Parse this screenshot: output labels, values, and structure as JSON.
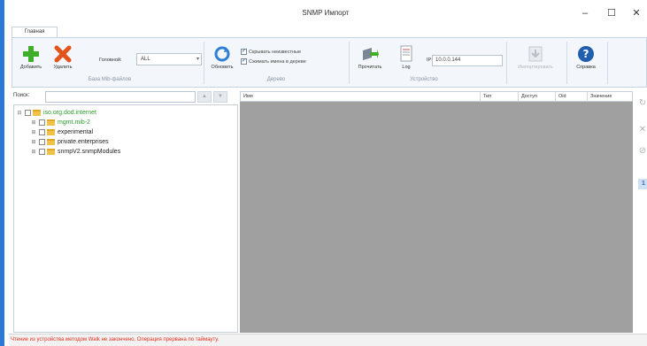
{
  "window": {
    "title": "SNMP Импорт",
    "minimize": "–",
    "maximize": "☐",
    "close": "✕"
  },
  "ribbon": {
    "tab": "Главная",
    "mib_group": {
      "add_label": "Добавить",
      "delete_label": "Удалить",
      "head_label": "Головной:",
      "head_value": "ALL",
      "group_label": "База Mib-файлов"
    },
    "tree_group": {
      "refresh_label": "Обновить",
      "hide_unknown_label": "Скрывать неизвестные",
      "compress_names_label": "Сжимать имена в дереве",
      "group_label": "Дерево"
    },
    "device_group": {
      "read_label": "Прочитать",
      "log_label": "Log",
      "ip_label": "IP:",
      "ip_value": "10.0.0.144",
      "group_label": "Устройство"
    },
    "import_label": "Импортировать",
    "help_label": "Справка"
  },
  "search": {
    "label": "Поиск:",
    "value": ""
  },
  "tree": {
    "root": "iso.org.dod.internet",
    "children": [
      "mgmt.mib-2",
      "experimental",
      "private.enterprises",
      "snmpV2.snmpModules"
    ]
  },
  "grid": {
    "columns": [
      "Имя",
      "Тип",
      "Доступ",
      "Oid",
      "Значение"
    ]
  },
  "side": {
    "count": "1"
  },
  "status": {
    "text": "Чтение из устройства методом Walk не закончено. Операция прервана по таймауту."
  },
  "colors": {
    "accent": "#2b79d6",
    "status_error": "#e0301e",
    "tree_root": "#2b9a2b",
    "grid_background": "#a0a0a0"
  }
}
